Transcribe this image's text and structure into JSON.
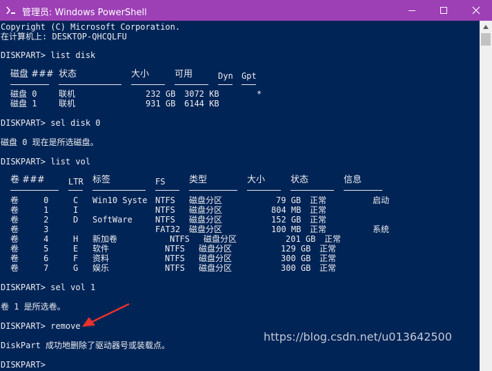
{
  "window": {
    "title": "管理员: Windows PowerShell",
    "accent": "#9d40b6",
    "background": "#012456",
    "icon": "powershell-icon"
  },
  "console": {
    "banner": [
      "Copyright (C) Microsoft Corporation.",
      "在计算机上: DESKTOP-QHCQLFU"
    ],
    "cmd_list_disk": "DISKPART> list disk",
    "disk_table": {
      "headers": [
        "磁盘 ###",
        "状态",
        "大小",
        "可用",
        "Dyn",
        "Gpt"
      ],
      "rows": [
        [
          "磁盘 0",
          "联机",
          "232 GB",
          "3072 KB",
          "",
          "*"
        ],
        [
          "磁盘 1",
          "联机",
          "931 GB",
          "6144 KB",
          "",
          ""
        ]
      ]
    },
    "cmd_sel_disk": "DISKPART> sel disk 0",
    "msg_disk_selected": "磁盘 0 现在是所选磁盘。",
    "cmd_list_vol": "DISKPART> list vol",
    "vol_table": {
      "headers": [
        "卷 ###",
        "LTR",
        "标签",
        "FS",
        "类型",
        "大小",
        "状态",
        "信息"
      ],
      "rows": [
        [
          "卷     0",
          "C",
          "Win10 Syste",
          "NTFS",
          "磁盘分区",
          "79 GB",
          "正常",
          "启动"
        ],
        [
          "卷     1",
          "I",
          "",
          "NTFS",
          "磁盘分区",
          "804 MB",
          "正常",
          ""
        ],
        [
          "卷     2",
          "D",
          "SoftWare",
          "NTFS",
          "磁盘分区",
          "152 GB",
          "正常",
          ""
        ],
        [
          "卷     3",
          "",
          "",
          "FAT32",
          "磁盘分区",
          "100 MB",
          "正常",
          "系统"
        ],
        [
          "卷     4",
          "H",
          "新加卷",
          "NTFS",
          "磁盘分区",
          "201 GB",
          "正常",
          ""
        ],
        [
          "卷     5",
          "E",
          "软件",
          "NTFS",
          "磁盘分区",
          "129 GB",
          "正常",
          ""
        ],
        [
          "卷     6",
          "F",
          "资料",
          "NTFS",
          "磁盘分区",
          "300 GB",
          "正常",
          ""
        ],
        [
          "卷     7",
          "G",
          "娱乐",
          "NTFS",
          "磁盘分区",
          "300 GB",
          "正常",
          ""
        ]
      ]
    },
    "cmd_sel_vol": "DISKPART> sel vol 1",
    "msg_vol_selected": "卷 1 是所选卷。",
    "cmd_remove": "DISKPART> remove",
    "msg_removed": "DiskPart 成功地删除了驱动器号或装载点。",
    "prompt": "DISKPART> "
  },
  "watermark": "https://blog.csdn.net/u013642500"
}
